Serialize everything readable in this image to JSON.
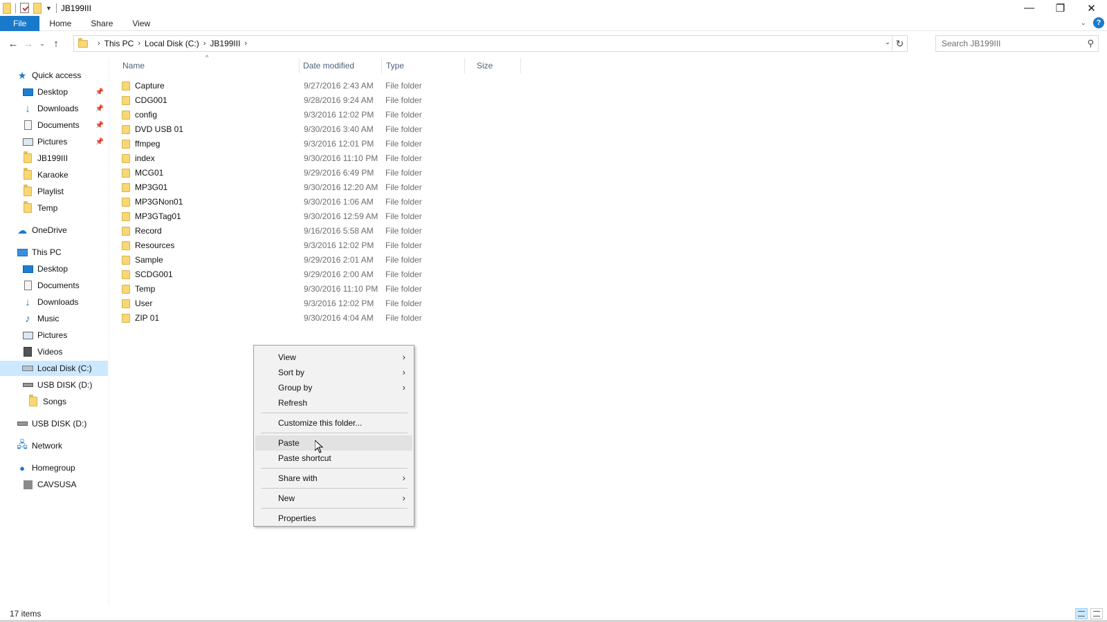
{
  "window": {
    "title": "JB199III",
    "controls": {
      "minimize": "—",
      "restore": "❐",
      "close": "✕"
    }
  },
  "ribbon": {
    "tabs": [
      {
        "label": "File"
      },
      {
        "label": "Home"
      },
      {
        "label": "Share"
      },
      {
        "label": "View"
      }
    ],
    "help": "?"
  },
  "address": {
    "breadcrumbs": [
      "This PC",
      "Local Disk (C:)",
      "JB199III"
    ]
  },
  "search": {
    "placeholder": "Search JB199III"
  },
  "nav": {
    "quick_access": "Quick access",
    "quick_items": [
      "Desktop",
      "Downloads",
      "Documents",
      "Pictures",
      "JB199III",
      "Karaoke",
      "Playlist",
      "Temp"
    ],
    "onedrive": "OneDrive",
    "this_pc": "This PC",
    "pc_items": [
      "Desktop",
      "Documents",
      "Downloads",
      "Music",
      "Pictures",
      "Videos",
      "Local Disk (C:)",
      "USB DISK (D:)"
    ],
    "songs": "Songs",
    "usb": "USB DISK (D:)",
    "network": "Network",
    "homegroup": "Homegroup",
    "cavsusa": "CAVSUSA"
  },
  "columns": {
    "name": "Name",
    "date": "Date modified",
    "type": "Type",
    "size": "Size"
  },
  "files": [
    {
      "name": "Capture",
      "date": "9/27/2016 2:43 AM",
      "type": "File folder"
    },
    {
      "name": "CDG001",
      "date": "9/28/2016 9:24 AM",
      "type": "File folder"
    },
    {
      "name": "config",
      "date": "9/3/2016 12:02 PM",
      "type": "File folder"
    },
    {
      "name": "DVD USB 01",
      "date": "9/30/2016 3:40 AM",
      "type": "File folder"
    },
    {
      "name": "ffmpeg",
      "date": "9/3/2016 12:01 PM",
      "type": "File folder"
    },
    {
      "name": "index",
      "date": "9/30/2016 11:10 PM",
      "type": "File folder"
    },
    {
      "name": "MCG01",
      "date": "9/29/2016 6:49 PM",
      "type": "File folder"
    },
    {
      "name": "MP3G01",
      "date": "9/30/2016 12:20 AM",
      "type": "File folder"
    },
    {
      "name": "MP3GNon01",
      "date": "9/30/2016 1:06 AM",
      "type": "File folder"
    },
    {
      "name": "MP3GTag01",
      "date": "9/30/2016 12:59 AM",
      "type": "File folder"
    },
    {
      "name": "Record",
      "date": "9/16/2016 5:58 AM",
      "type": "File folder"
    },
    {
      "name": "Resources",
      "date": "9/3/2016 12:02 PM",
      "type": "File folder"
    },
    {
      "name": "Sample",
      "date": "9/29/2016 2:01 AM",
      "type": "File folder"
    },
    {
      "name": "SCDG001",
      "date": "9/29/2016 2:00 AM",
      "type": "File folder"
    },
    {
      "name": "Temp",
      "date": "9/30/2016 11:10 PM",
      "type": "File folder"
    },
    {
      "name": "User",
      "date": "9/3/2016 12:02 PM",
      "type": "File folder"
    },
    {
      "name": "ZIP 01",
      "date": "9/30/2016 4:04 AM",
      "type": "File folder"
    }
  ],
  "context_menu": {
    "view": "View",
    "sort_by": "Sort by",
    "group_by": "Group by",
    "refresh": "Refresh",
    "customize": "Customize this folder...",
    "paste": "Paste",
    "paste_shortcut": "Paste shortcut",
    "share_with": "Share with",
    "new": "New",
    "properties": "Properties"
  },
  "status": {
    "items": "17 items"
  },
  "colors": {
    "accent": "#1979ca",
    "selected": "#cce8ff",
    "menu_bg": "#f2f2f2",
    "menu_hover": "#e2e2e2"
  }
}
